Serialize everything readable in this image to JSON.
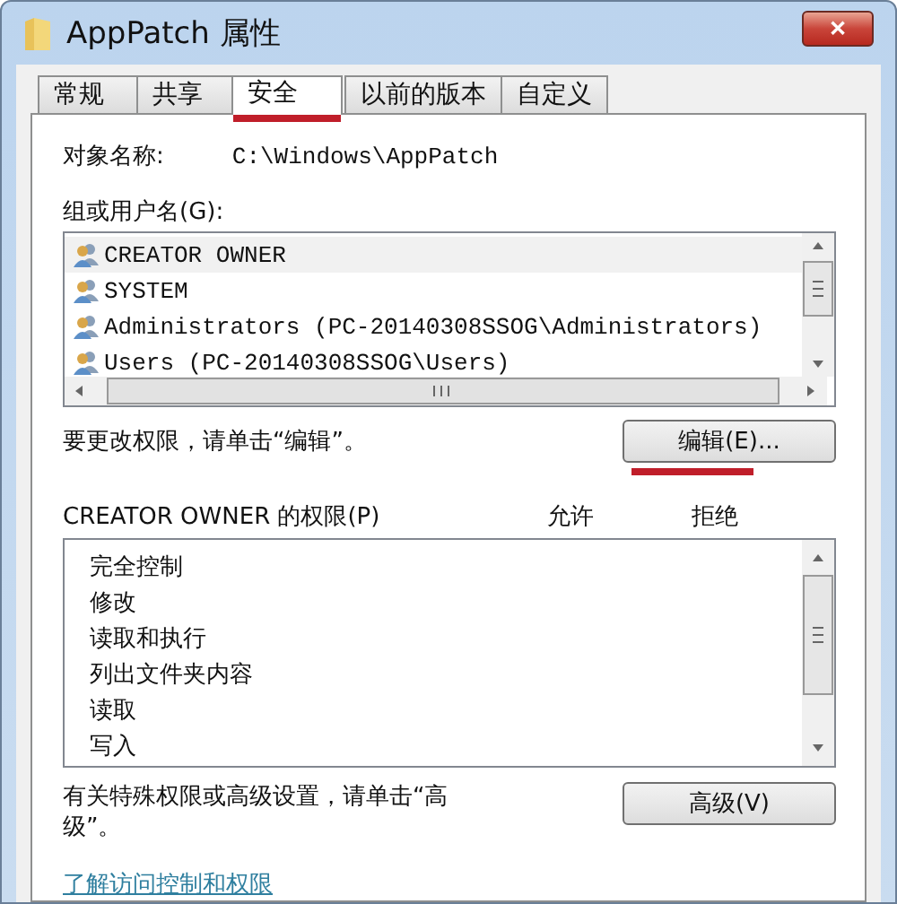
{
  "window": {
    "title": "AppPatch 属性",
    "close": "✕"
  },
  "tabs": [
    {
      "label": "常规",
      "selected": false
    },
    {
      "label": "共享",
      "selected": false
    },
    {
      "label": "安全",
      "selected": true
    },
    {
      "label": "以前的版本",
      "selected": false
    },
    {
      "label": "自定义",
      "selected": false
    }
  ],
  "object_name": {
    "label": "对象名称:",
    "value": "C:\\Windows\\AppPatch"
  },
  "groups": {
    "label": "组或用户名(G):",
    "items": [
      {
        "name": "CREATOR OWNER",
        "selected": true
      },
      {
        "name": "SYSTEM",
        "selected": false
      },
      {
        "name": "Administrators (PC-20140308SSOG\\Administrators)",
        "selected": false
      },
      {
        "name": "Users (PC-20140308SSOG\\Users)",
        "selected": false
      }
    ]
  },
  "edit_hint": "要更改权限，请单击“编辑”。",
  "edit_button": {
    "label": "编辑(E)...",
    "highlighted": true
  },
  "permissions": {
    "label": "CREATOR OWNER 的权限(P)",
    "allow": "允许",
    "deny": "拒绝",
    "items": [
      "完全控制",
      "修改",
      "读取和执行",
      "列出文件夹内容",
      "读取",
      "写入"
    ]
  },
  "advanced_hint": "有关特殊权限或高级设置，请单击“高级”。",
  "advanced_button": {
    "label": "高级(V)"
  },
  "link": "了解访问控制和权限"
}
